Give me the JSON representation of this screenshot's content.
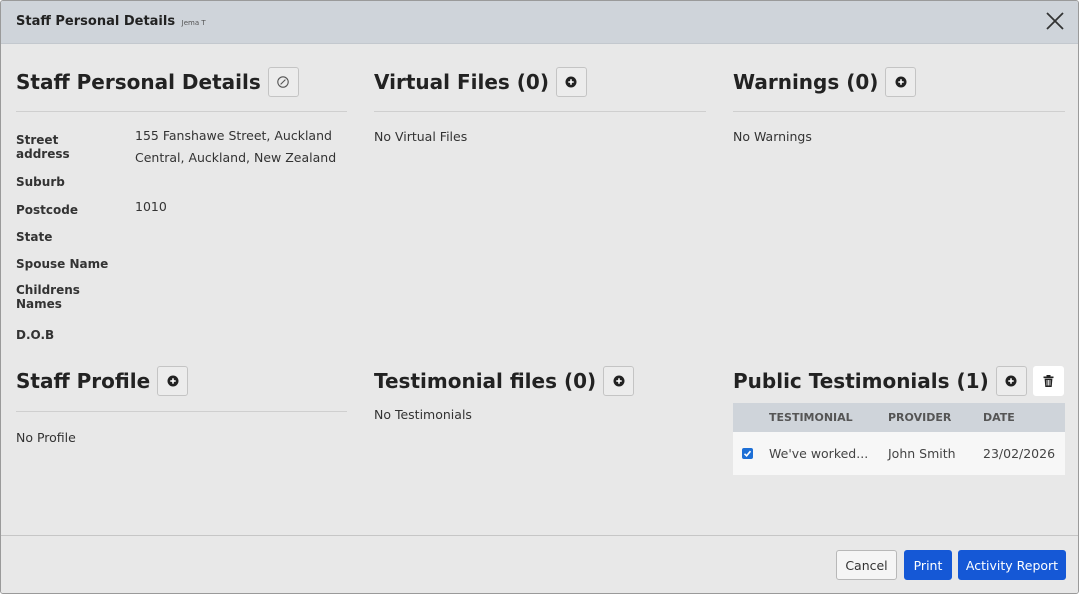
{
  "modal": {
    "title": "Staff Personal Details",
    "subtitle": "Jema T"
  },
  "personal": {
    "title": "Staff Personal Details",
    "fields": [
      {
        "label": "Street address",
        "value": "155 Fanshawe Street, Auckland Central, Auckland, New Zealand"
      },
      {
        "label": "Suburb",
        "value": ""
      },
      {
        "label": "Postcode",
        "value": "1010"
      },
      {
        "label": "State",
        "value": ""
      },
      {
        "label": "Spouse Name",
        "value": ""
      },
      {
        "label": "Childrens Names",
        "value": ""
      },
      {
        "label": "D.O.B",
        "value": ""
      }
    ]
  },
  "virtual_files": {
    "title": "Virtual Files (0)",
    "empty": "No Virtual Files"
  },
  "warnings": {
    "title": "Warnings (0)",
    "empty": "No Warnings"
  },
  "staff_profile": {
    "title": "Staff Profile",
    "empty": "No Profile"
  },
  "testimonial_files": {
    "title": "Testimonial files (0)",
    "empty": "No Testimonials"
  },
  "public_testimonials": {
    "title": "Public Testimonials (1)",
    "columns": [
      "TESTIMONIAL",
      "PROVIDER",
      "DATE"
    ],
    "rows": [
      {
        "checked": true,
        "testimonial": "We've worked...",
        "provider": "John Smith",
        "date": "23/02/2026"
      }
    ]
  },
  "footer": {
    "cancel": "Cancel",
    "print": "Print",
    "activity_report": "Activity Report"
  },
  "icons": {
    "close": "close-icon",
    "edit": "edit-icon",
    "add": "add-icon",
    "delete": "trash-icon"
  },
  "colors": {
    "primary": "#1558d6",
    "header_bg": "#cfd4da",
    "modal_bg": "#e8e8e8"
  }
}
